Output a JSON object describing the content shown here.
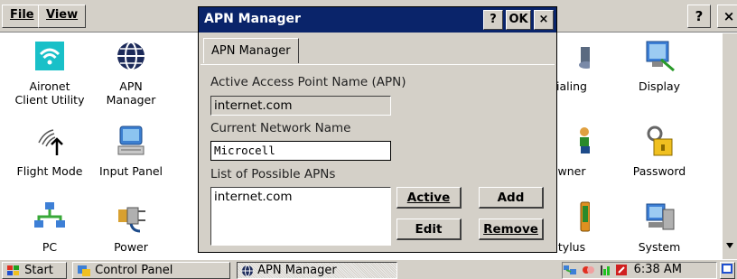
{
  "control_panel": {
    "menu": {
      "file": "File",
      "view": "View"
    },
    "help_button": "?",
    "close_button": "×",
    "items": [
      {
        "label1": "Aironet",
        "label2": "Client Utility",
        "icon": "wifi-icon"
      },
      {
        "label1": "APN",
        "label2": "Manager",
        "icon": "globe-icon"
      },
      {
        "label1": "Flight Mode",
        "label2": "",
        "icon": "antenna-icon"
      },
      {
        "label1": "Input Panel",
        "label2": "",
        "icon": "keyboard-icon"
      },
      {
        "label1": "PC",
        "label2": "",
        "icon": "network-icon"
      },
      {
        "label1": "Power",
        "label2": "",
        "icon": "power-plug-icon"
      },
      {
        "label1": "ialing",
        "label2": "",
        "icon": "dialing-icon"
      },
      {
        "label1": "Display",
        "label2": "",
        "icon": "display-icon"
      },
      {
        "label1": "wner",
        "label2": "",
        "icon": "owner-icon"
      },
      {
        "label1": "Password",
        "label2": "",
        "icon": "password-key-icon"
      },
      {
        "label1": "tylus",
        "label2": "",
        "icon": "stylus-icon"
      },
      {
        "label1": "System",
        "label2": "",
        "icon": "system-icon"
      }
    ]
  },
  "dialog": {
    "title": "APN Manager",
    "help_button": "?",
    "ok_button": "OK",
    "close_button": "×",
    "tab": "APN Manager",
    "active_apn_label": "Active Access Point Name (APN)",
    "active_apn_value": "internet.com",
    "network_name_label": "Current Network Name",
    "network_name_value": "Microcell",
    "possible_apns_label": "List of Possible APNs",
    "possible_apns": [
      "internet.com"
    ],
    "buttons": {
      "active": "Active",
      "add": "Add",
      "edit": "Edit",
      "remove": "Remove"
    }
  },
  "taskbar": {
    "start": "Start",
    "tasks": [
      "Control Panel",
      "APN Manager"
    ],
    "active_task": "APN Manager",
    "time": "6:38 AM"
  }
}
